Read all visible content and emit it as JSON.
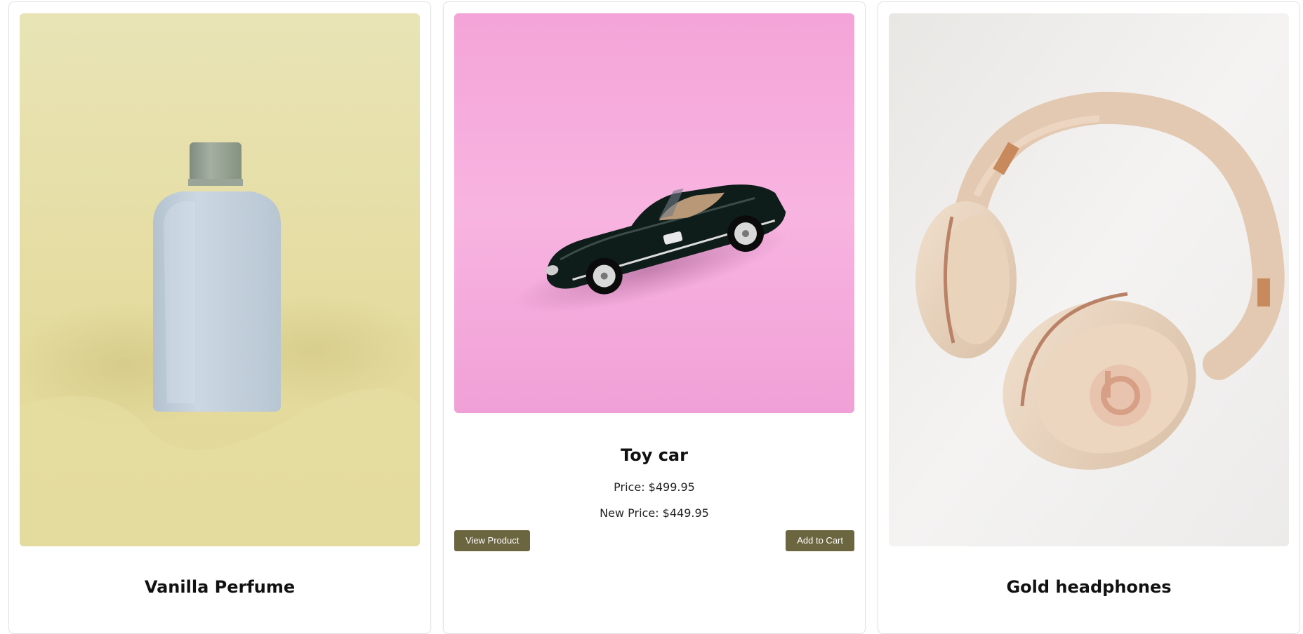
{
  "products": [
    {
      "name": "Vanilla Perfume",
      "image": "perfume-bottle-photo",
      "colors": {
        "background": "#e6df9e",
        "bottle": "#c7d4e2",
        "cap": "#8f9c90"
      }
    },
    {
      "name": "Toy car",
      "image": "toy-car-photo",
      "price_label": "Price: $499.95",
      "new_price_label": "New Price: $449.95",
      "view_label": "View Product",
      "cart_label": "Add to Cart",
      "colors": {
        "background": "#f7a9dc",
        "car": "#0d1c19",
        "button": "#6b6540"
      }
    },
    {
      "name": "Gold headphones",
      "image": "headphones-photo",
      "colors": {
        "background": "#f2f1f0",
        "headphones": "#e7d1bb",
        "accent": "#b98266"
      }
    }
  ]
}
